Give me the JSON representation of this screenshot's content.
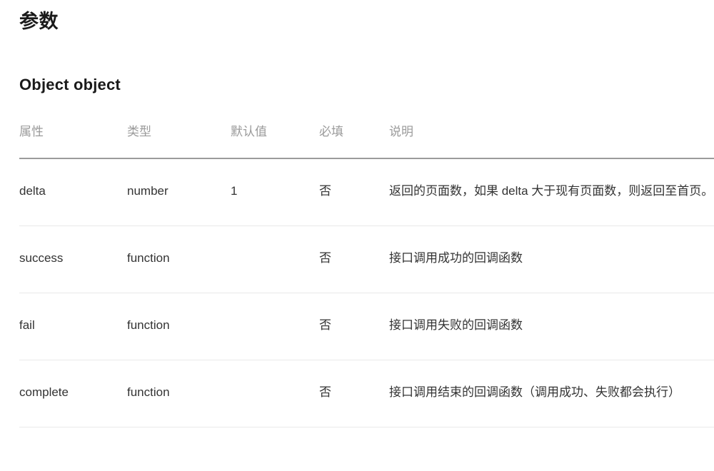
{
  "page": {
    "section_title": "参数",
    "subsection_title": "Object object"
  },
  "table": {
    "headers": {
      "attribute": "属性",
      "type": "类型",
      "default": "默认值",
      "required": "必填",
      "description": "说明"
    },
    "rows": [
      {
        "attribute": "delta",
        "type": "number",
        "default": "1",
        "required": "否",
        "description": "返回的页面数，如果 delta 大于现有页面数，则返回至首页。"
      },
      {
        "attribute": "success",
        "type": "function",
        "default": "",
        "required": "否",
        "description": "接口调用成功的回调函数"
      },
      {
        "attribute": "fail",
        "type": "function",
        "default": "",
        "required": "否",
        "description": "接口调用失败的回调函数"
      },
      {
        "attribute": "complete",
        "type": "function",
        "default": "",
        "required": "否",
        "description": "接口调用结束的回调函数（调用成功、失败都会执行）"
      }
    ]
  },
  "colors": {
    "background": "#ffffff",
    "heading_text": "#1a1a1a",
    "body_text": "#333333",
    "header_text": "#9a9a9a",
    "header_rule": "#9b9b9b",
    "row_rule": "#e9e9e9"
  }
}
